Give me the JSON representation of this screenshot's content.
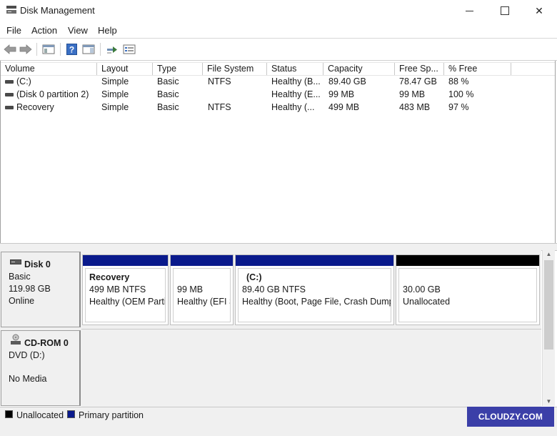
{
  "window": {
    "title": "Disk Management"
  },
  "menu": [
    "File",
    "Action",
    "View",
    "Help"
  ],
  "toolbar": {
    "icons": [
      "back-arrow-icon",
      "forward-arrow-icon",
      "console-tree-icon",
      "help-icon",
      "properties-icon",
      "connect-icon",
      "list-view-icon"
    ]
  },
  "volume_list": {
    "columns": [
      "Volume",
      "Layout",
      "Type",
      "File System",
      "Status",
      "Capacity",
      "Free Sp...",
      "% Free"
    ],
    "rows": [
      {
        "volume": "(C:)",
        "layout": "Simple",
        "type": "Basic",
        "fs": "NTFS",
        "status": "Healthy (B...",
        "capacity": "89.40 GB",
        "free": "78.47 GB",
        "pct": "88 %"
      },
      {
        "volume": "(Disk 0 partition 2)",
        "layout": "Simple",
        "type": "Basic",
        "fs": "",
        "status": "Healthy (E...",
        "capacity": "99 MB",
        "free": "99 MB",
        "pct": "100 %"
      },
      {
        "volume": "Recovery",
        "layout": "Simple",
        "type": "Basic",
        "fs": "NTFS",
        "status": "Healthy (...",
        "capacity": "499 MB",
        "free": "483 MB",
        "pct": "97 %"
      }
    ]
  },
  "disks": [
    {
      "name": "Disk 0",
      "type": "Basic",
      "size": "119.98 GB",
      "state": "Online",
      "partitions": [
        {
          "name": "Recovery",
          "size": "499 MB NTFS",
          "status": "Healthy (OEM Parti",
          "bar": "#0a1a8c"
        },
        {
          "name": "",
          "size": "99 MB",
          "status": "Healthy (EFI S",
          "bar": "#0a1a8c"
        },
        {
          "name": "(C:)",
          "size": "89.40 GB NTFS",
          "status": "Healthy (Boot, Page File, Crash Dump,",
          "bar": "#0a1a8c"
        },
        {
          "name": "",
          "size": "30.00 GB",
          "status": "Unallocated",
          "bar": "#000000"
        }
      ]
    },
    {
      "name": "CD-ROM 0",
      "type": "DVD (D:)",
      "state": "No Media"
    }
  ],
  "legend": [
    {
      "label": "Unallocated",
      "color": "#000000"
    },
    {
      "label": "Primary partition",
      "color": "#0a1a8c"
    }
  ],
  "watermark": "CLOUDZY.COM"
}
